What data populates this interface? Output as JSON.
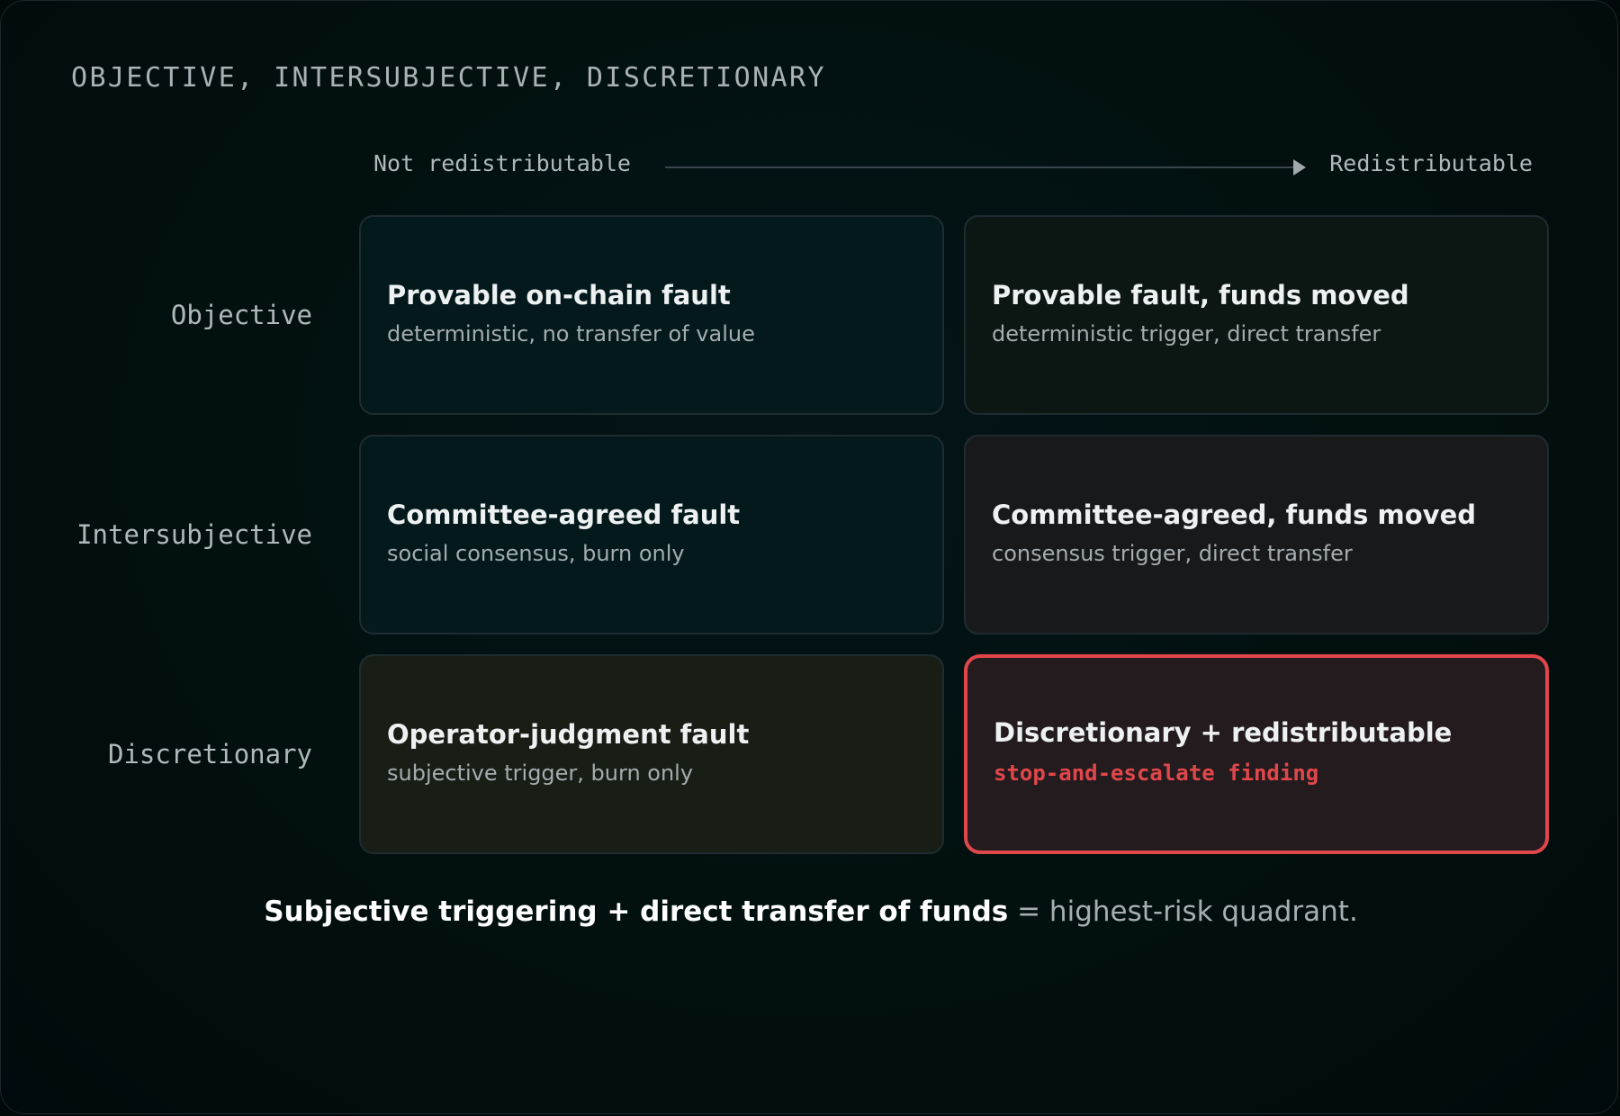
{
  "title": "OBJECTIVE, INTERSUBJECTIVE, DISCRETIONARY",
  "x_axis": {
    "left_label": "Not redistributable",
    "right_label": "Redistributable"
  },
  "rows": [
    {
      "label": "Objective",
      "cells": [
        {
          "title": "Provable on-chain fault",
          "subtitle": "deterministic, no transfer of value",
          "bg": "#03191c"
        },
        {
          "title": "Provable fault, funds moved",
          "subtitle": "deterministic trigger, direct transfer",
          "bg": "#0c1612"
        }
      ]
    },
    {
      "label": "Intersubjective",
      "cells": [
        {
          "title": "Committee-agreed fault",
          "subtitle": "social consensus, burn only",
          "bg": "#03191c"
        },
        {
          "title": "Committee-agreed, funds moved",
          "subtitle": "consensus trigger, direct transfer",
          "bg": "#17191b"
        }
      ]
    },
    {
      "label": "Discretionary",
      "cells": [
        {
          "title": "Operator-judgment fault",
          "subtitle": "subjective trigger, burn only",
          "bg": "#181e16"
        },
        {
          "title": "Discretionary + redistributable",
          "subtitle": "stop-and-escalate finding",
          "bg": "#241b1e",
          "accent": "#e0474b"
        }
      ]
    }
  ],
  "footer": {
    "strong": "Subjective triggering + direct transfer of funds",
    "rest": " = highest-risk quadrant."
  }
}
